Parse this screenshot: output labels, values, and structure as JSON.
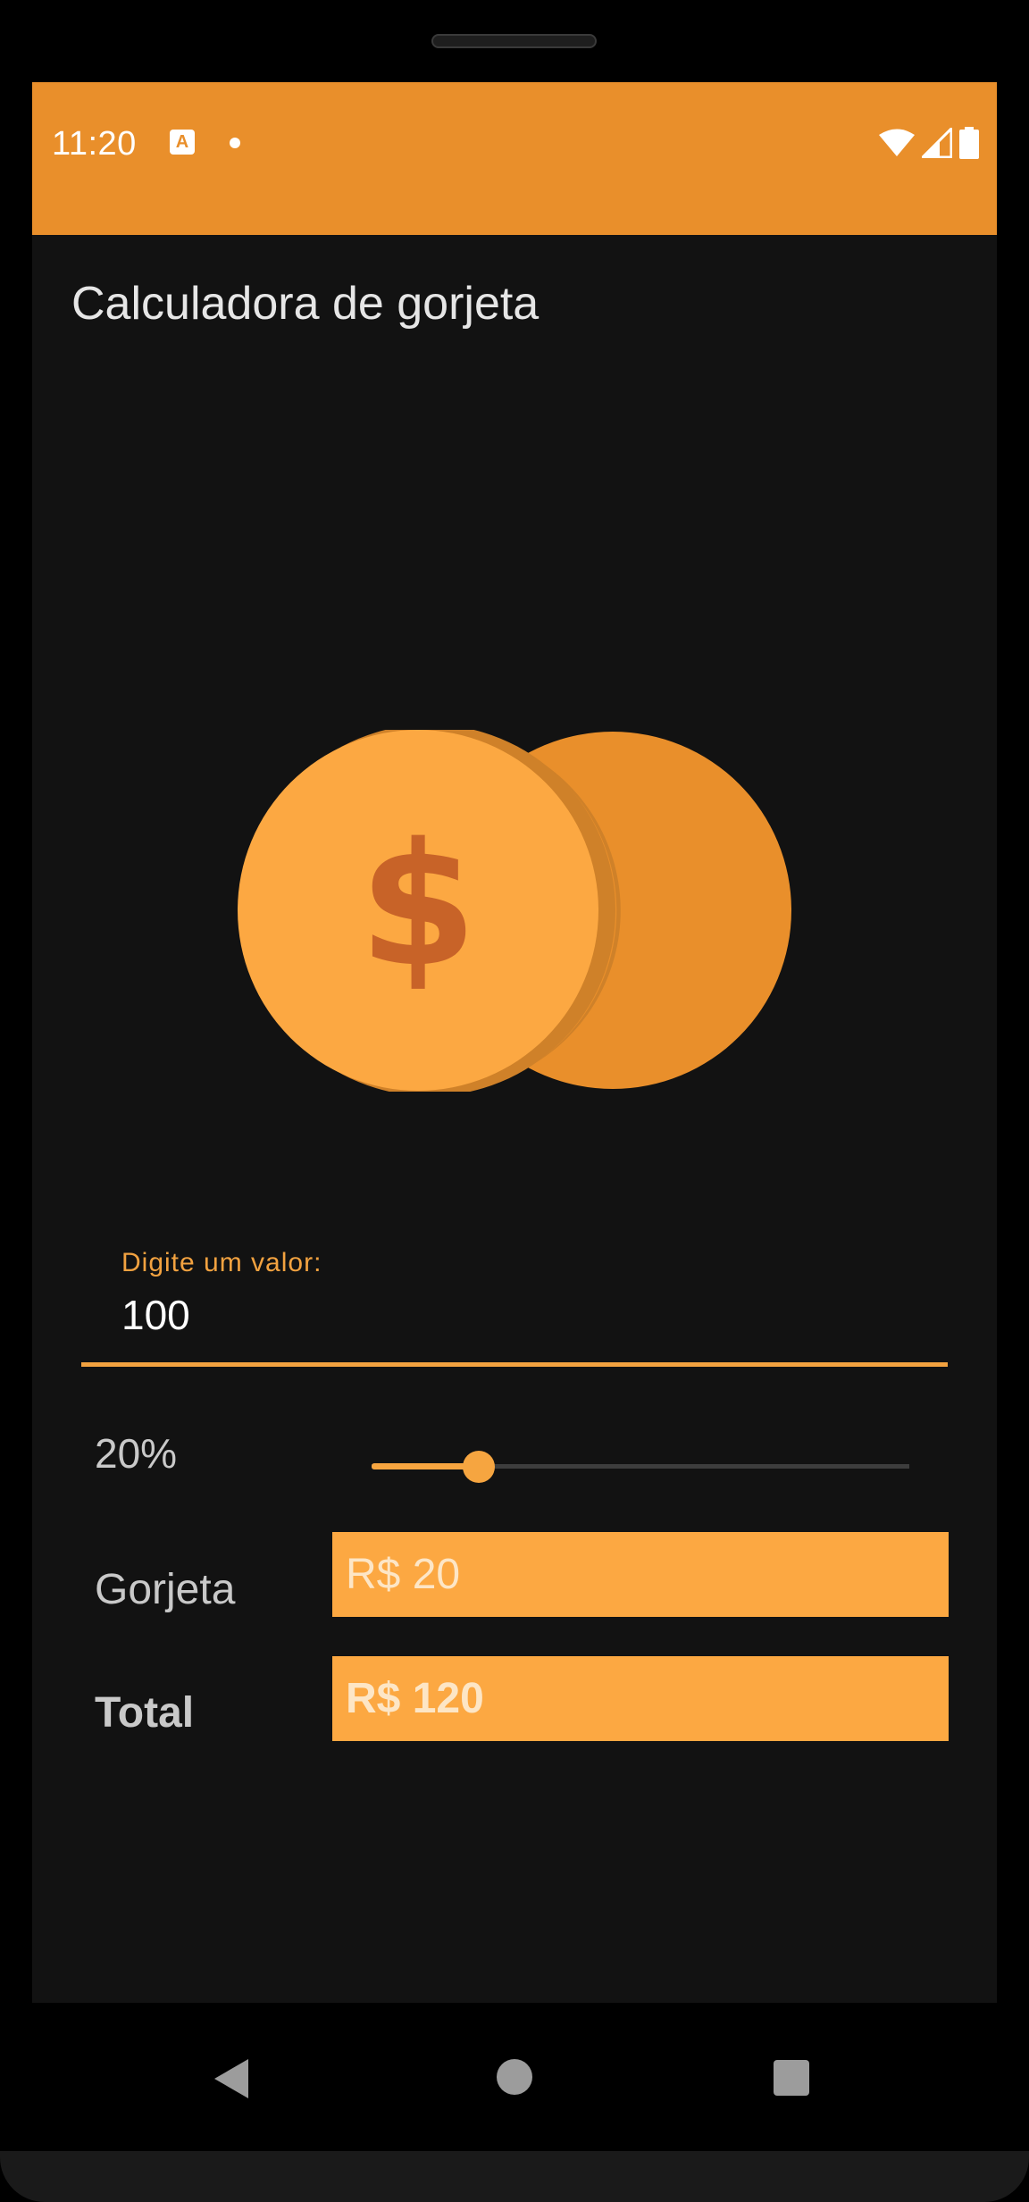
{
  "status_bar": {
    "time": "11:20",
    "notification_icon": "app-notification-icon",
    "notification_letter": "A",
    "icons": [
      "wifi-icon",
      "cell-signal-icon",
      "battery-icon"
    ],
    "background_color": "#e98f2b"
  },
  "app": {
    "title": "Calculadora de gorjeta",
    "illustration": "coins-dollar-icon"
  },
  "input": {
    "label": "Digite um valor:",
    "value": "100"
  },
  "slider": {
    "label": "20%",
    "value_fraction": 0.2,
    "accent_color": "#f6a540"
  },
  "results": {
    "tip_label": "Gorjeta",
    "tip_value": "R$ 20",
    "total_label": "Total",
    "total_value": "R$ 120",
    "box_color": "#fca842"
  },
  "nav": {
    "icons": [
      "back-icon",
      "home-icon",
      "recent-apps-icon"
    ]
  }
}
